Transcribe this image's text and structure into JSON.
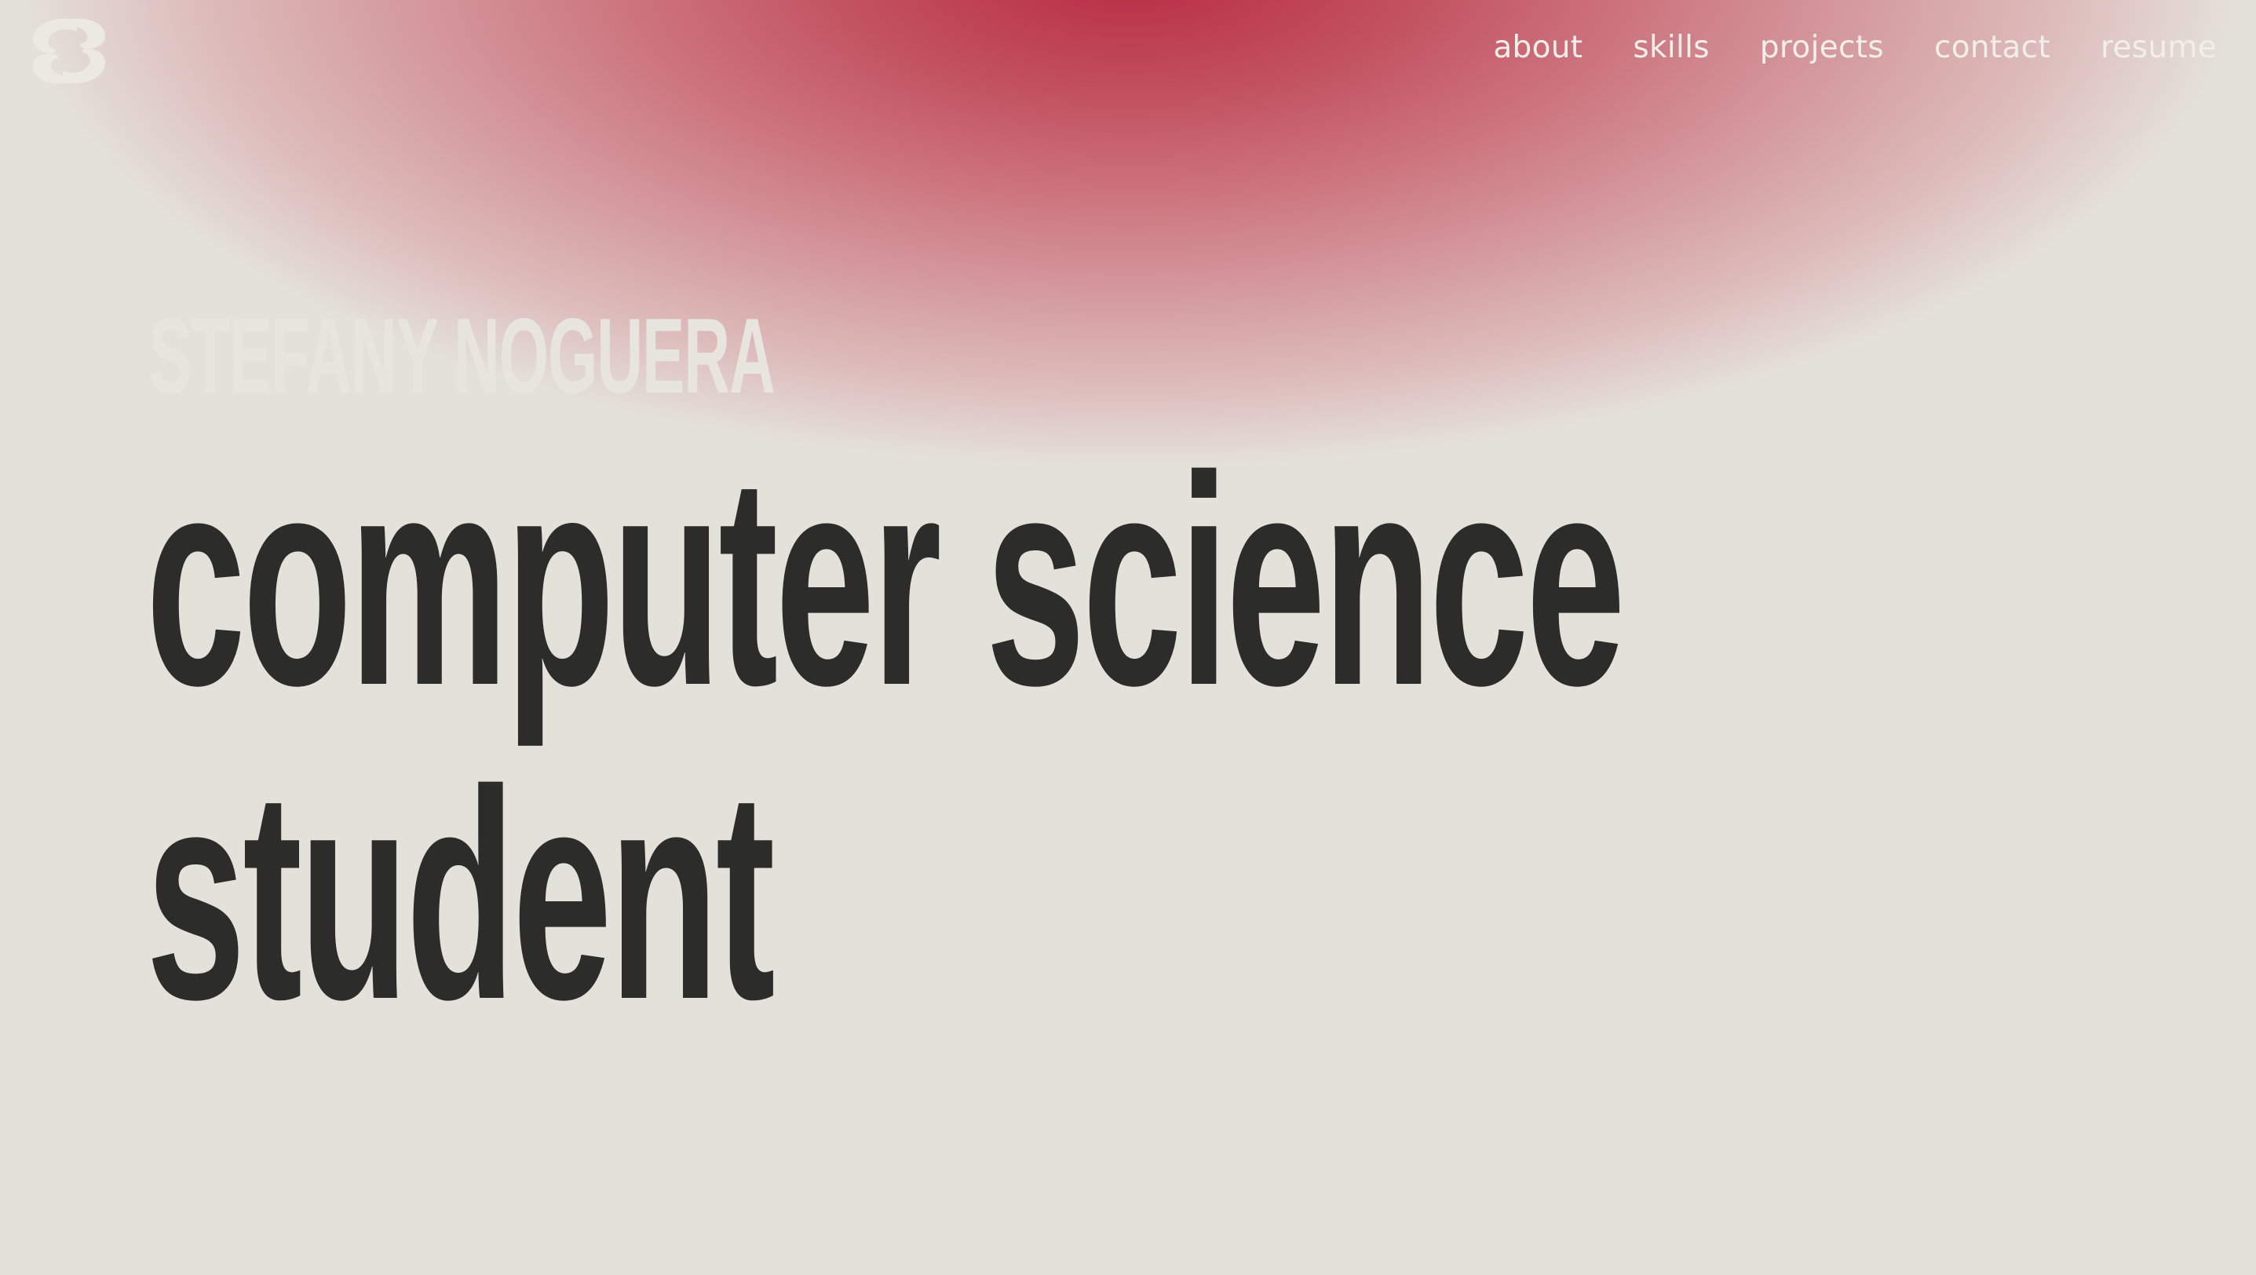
{
  "logo": {
    "icon": "s-monogram-icon",
    "color": "#ece8e2"
  },
  "nav": {
    "items": [
      {
        "label": "about"
      },
      {
        "label": "skills"
      },
      {
        "label": "projects"
      },
      {
        "label": "contact"
      },
      {
        "label": "resume"
      }
    ]
  },
  "hero": {
    "name": "STEFANY NOGUERA",
    "headline_line1": "computer science",
    "headline_line2": "student"
  },
  "colors": {
    "background": "#e4e1db",
    "gradient_accent": "#b82a43",
    "headline_text": "#2c2c2a",
    "light_text": "#f2eeea"
  }
}
